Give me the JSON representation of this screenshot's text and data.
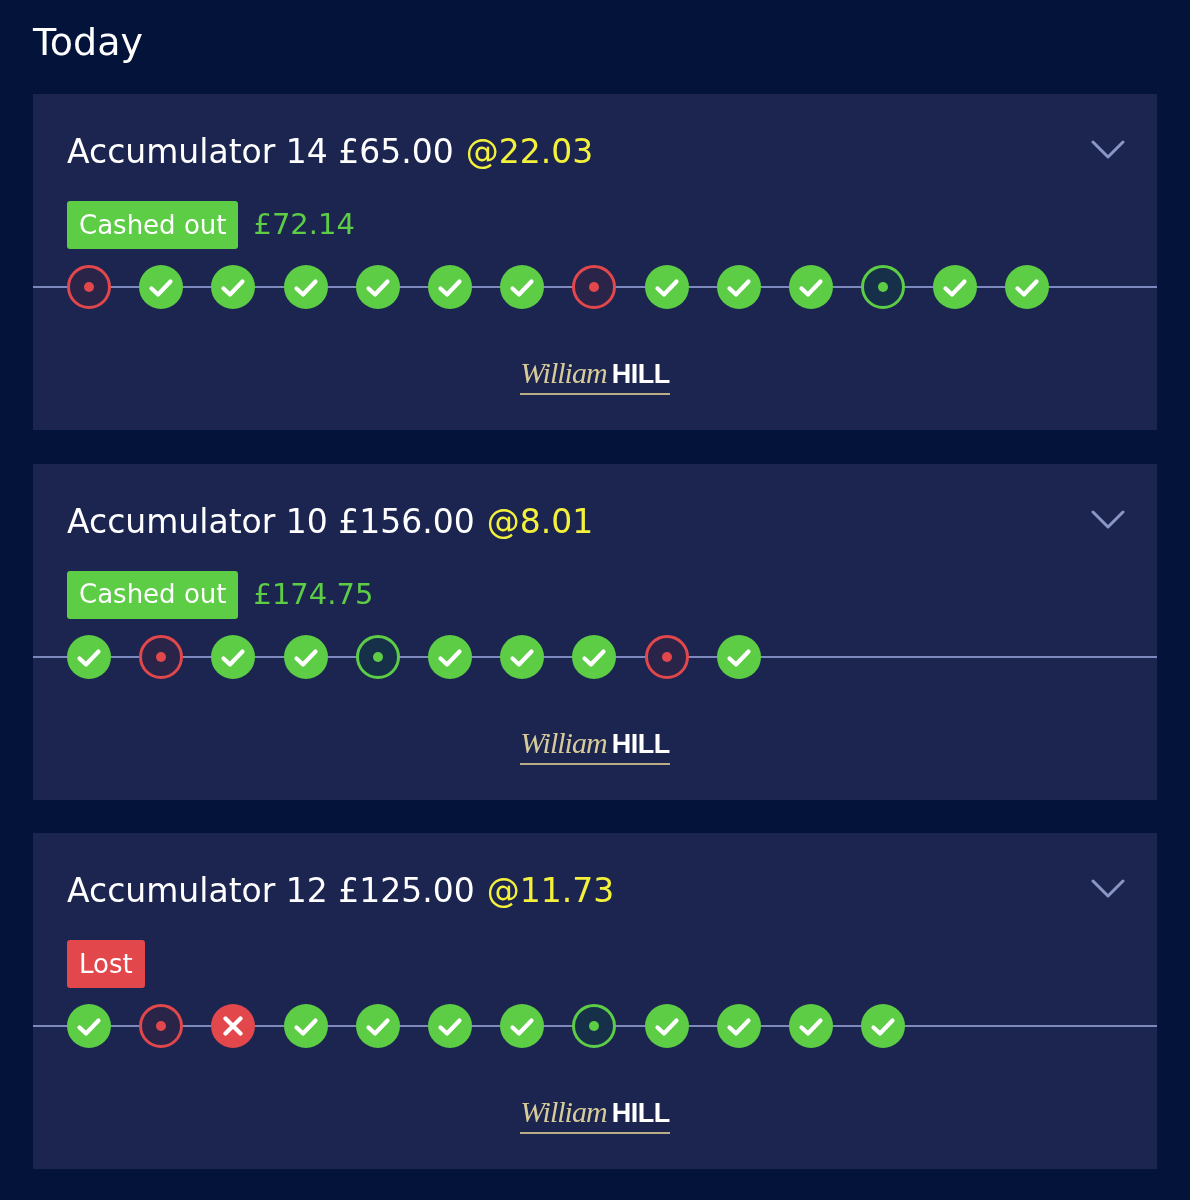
{
  "heading": "Today",
  "cards": [
    {
      "title": "Accumulator 14 £65.00",
      "odds": "@22.03",
      "expanded": false,
      "status": {
        "label": "Cashed out",
        "kind": "cashed_out"
      },
      "amount": "£72.14",
      "legs": [
        {
          "kind": "ring_red"
        },
        {
          "kind": "tick"
        },
        {
          "kind": "tick"
        },
        {
          "kind": "tick"
        },
        {
          "kind": "tick"
        },
        {
          "kind": "tick"
        },
        {
          "kind": "tick"
        },
        {
          "kind": "ring_red"
        },
        {
          "kind": "tick"
        },
        {
          "kind": "tick"
        },
        {
          "kind": "tick"
        },
        {
          "kind": "ring_green"
        },
        {
          "kind": "tick"
        },
        {
          "kind": "tick"
        }
      ],
      "logo": {
        "script": "William",
        "wordmark": "HILL"
      }
    },
    {
      "title": "Accumulator 10 £156.00",
      "odds": "@8.01",
      "expanded": false,
      "status": {
        "label": "Cashed out",
        "kind": "cashed_out"
      },
      "amount": "£174.75",
      "legs": [
        {
          "kind": "tick"
        },
        {
          "kind": "ring_red"
        },
        {
          "kind": "tick"
        },
        {
          "kind": "tick"
        },
        {
          "kind": "ring_green"
        },
        {
          "kind": "tick"
        },
        {
          "kind": "tick"
        },
        {
          "kind": "tick"
        },
        {
          "kind": "ring_red"
        },
        {
          "kind": "tick"
        }
      ],
      "logo": {
        "script": "William",
        "wordmark": "HILL"
      }
    },
    {
      "title": "Accumulator 12 £125.00",
      "odds": "@11.73",
      "expanded": false,
      "status": {
        "label": "Lost",
        "kind": "lost"
      },
      "legs": [
        {
          "kind": "tick"
        },
        {
          "kind": "ring_red"
        },
        {
          "kind": "cross"
        },
        {
          "kind": "tick"
        },
        {
          "kind": "tick"
        },
        {
          "kind": "tick"
        },
        {
          "kind": "tick"
        },
        {
          "kind": "ring_green"
        },
        {
          "kind": "tick"
        },
        {
          "kind": "tick"
        },
        {
          "kind": "tick"
        },
        {
          "kind": "tick"
        }
      ],
      "logo": {
        "script": "William",
        "wordmark": "HILL"
      }
    }
  ]
}
